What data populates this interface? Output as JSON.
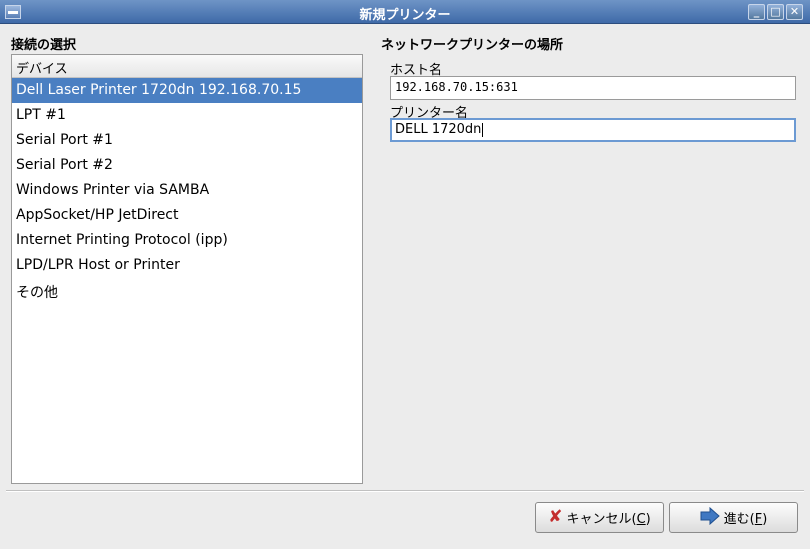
{
  "window": {
    "title": "新規プリンター"
  },
  "left_panel": {
    "label": "接続の選択",
    "column_header": "デバイス",
    "items": [
      "Dell Laser Printer 1720dn 192.168.70.15",
      "LPT #1",
      "Serial Port #1",
      "Serial Port #2",
      "Windows Printer via SAMBA",
      "AppSocket/HP JetDirect",
      "Internet Printing Protocol (ipp)",
      "LPD/LPR Host or Printer",
      "その他"
    ],
    "selected_index": 0
  },
  "right_panel": {
    "label": "ネットワークプリンターの場所",
    "host_label": "ホスト名",
    "host_value": "192.168.70.15:631",
    "printer_name_label": "プリンター名",
    "printer_name_value": "DELL 1720dn"
  },
  "buttons": {
    "cancel_text": "キャンセル(",
    "cancel_mnemonic": "C",
    "cancel_close": ")",
    "forward_text": "進む(",
    "forward_mnemonic": "F",
    "forward_close": ")"
  },
  "colors": {
    "selection": "#4a7fc2",
    "titlebar": "#3f6aa8"
  }
}
